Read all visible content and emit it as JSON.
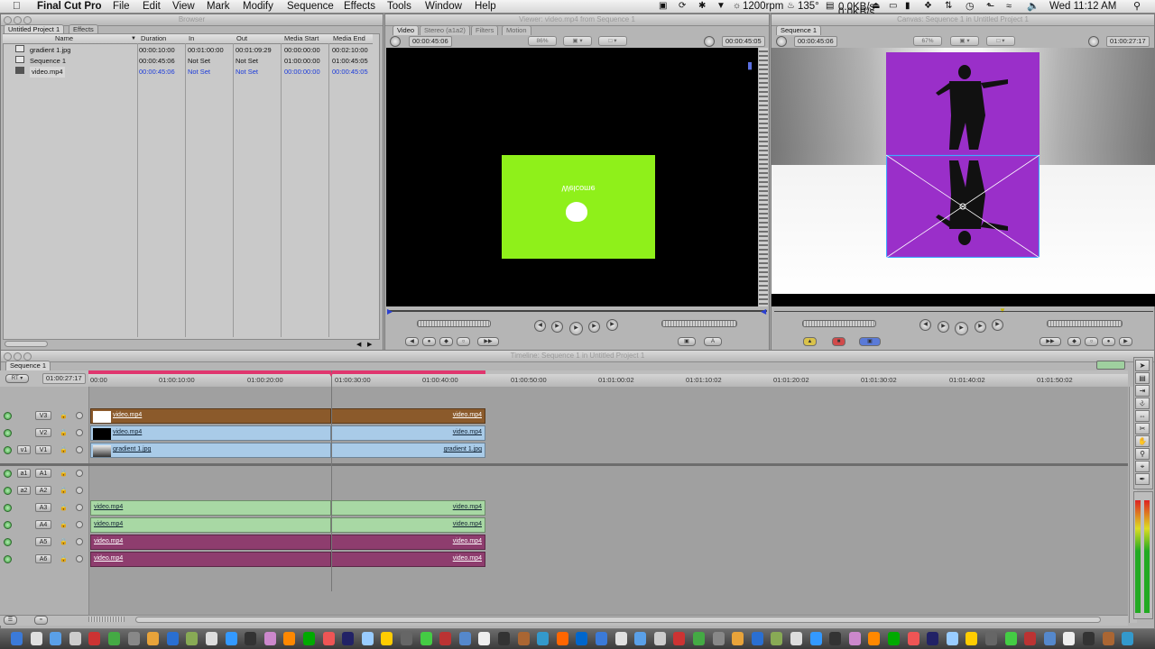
{
  "menubar": {
    "apple": "",
    "app_name": "Final Cut Pro",
    "items": [
      "File",
      "Edit",
      "View",
      "Mark",
      "Modify",
      "Sequence",
      "Effects",
      "Tools",
      "Window",
      "Help"
    ],
    "status": {
      "rpm": "1200rpm",
      "temp": "135°",
      "net_up": "0.0KB/s",
      "net_down": "0.0KB/s",
      "clock": "Wed 11:12 AM"
    }
  },
  "browser": {
    "title": "Browser",
    "tabs": [
      "Untitled Project 1",
      "Effects"
    ],
    "columns": [
      "Name",
      "Duration",
      "In",
      "Out",
      "Media Start",
      "Media End"
    ],
    "rows": [
      {
        "name": "gradient 1.jpg",
        "duration": "00:00:10:00",
        "in": "00:01:00:00",
        "out": "00:01:09:29",
        "media_start": "00:00:00:00",
        "media_end": "00:02:10:00",
        "selected": false
      },
      {
        "name": "Sequence 1",
        "duration": "00:00:45:06",
        "in": "Not Set",
        "out": "Not Set",
        "media_start": "01:00:00:00",
        "media_end": "01:00:45:05",
        "selected": false
      },
      {
        "name": "video.mp4",
        "duration": "00:00:45:06",
        "in": "Not Set",
        "out": "Not Set",
        "media_start": "00:00:00:00",
        "media_end": "00:00:45:05",
        "selected": true
      }
    ]
  },
  "viewer": {
    "title": "Viewer: video.mp4 from Sequence 1",
    "tabs": [
      "Video",
      "Stereo (a1a2)",
      "Filters",
      "Motion"
    ],
    "tc_duration": "00:00:45:06",
    "tc_current": "00:00:45:05",
    "zoom": "86%",
    "frame_text": "Welcome",
    "frame_color": "#8ff01a"
  },
  "canvas": {
    "title": "Canvas: Sequence 1 in Untitled Project 1",
    "tab": "Sequence 1",
    "tc_duration": "00:00:45:06",
    "tc_current": "01:00:27:17",
    "zoom": "67%",
    "frame_color": "#9a2fc9"
  },
  "timeline": {
    "title": "Timeline: Sequence 1 in Untitled Project 1",
    "tab": "Sequence 1",
    "rt_label": "RT",
    "current_tc": "01:00:27:17",
    "ruler": [
      "00:00",
      "01:00:10:00",
      "01:00:20:00",
      "01:00:30:00",
      "01:00:40:00",
      "01:00:50:00",
      "01:01:00:02",
      "01:01:10:02",
      "01:01:20:02",
      "01:01:30:02",
      "01:01:40:02",
      "01:01:50:02"
    ],
    "video_tracks": [
      {
        "label": "V3",
        "src": "",
        "left_clip": "video.mp4",
        "right_clip": "video.mp4",
        "color": "#8b5a2b"
      },
      {
        "label": "V2",
        "src": "",
        "left_clip": "video.mp4",
        "right_clip": "video.mp4",
        "color": "#a9cbe8"
      },
      {
        "label": "V1",
        "src": "v1",
        "left_clip": "gradient 1.jpg",
        "right_clip": "gradient 1.jpg",
        "color": "#a9cbe8"
      }
    ],
    "audio_tracks": [
      {
        "label": "A1",
        "src": "a1",
        "left_clip": "",
        "right_clip": "",
        "color": ""
      },
      {
        "label": "A2",
        "src": "a2",
        "left_clip": "",
        "right_clip": "",
        "color": ""
      },
      {
        "label": "A3",
        "src": "",
        "left_clip": "video.mp4",
        "right_clip": "video.mp4",
        "color": "#a8d8a4"
      },
      {
        "label": "A4",
        "src": "",
        "left_clip": "video.mp4",
        "right_clip": "video.mp4",
        "color": "#a8d8a4"
      },
      {
        "label": "A5",
        "src": "",
        "left_clip": "video.mp4",
        "right_clip": "video.mp4",
        "color": "#8e3d6e"
      },
      {
        "label": "A6",
        "src": "",
        "left_clip": "video.mp4",
        "right_clip": "video.mp4",
        "color": "#8e3d6e"
      }
    ]
  },
  "tools": [
    "select-tool",
    "edit-select-tool",
    "track-select-tool",
    "roll-tool",
    "slip-tool",
    "razor-tool",
    "zoom-tool",
    "crop-tool",
    "pen-tool"
  ],
  "audio_meter": {
    "labels": [
      "0",
      "-6",
      "-12",
      "-18",
      "-24",
      "-30",
      "-36",
      "-42",
      "-48",
      "-54"
    ]
  }
}
